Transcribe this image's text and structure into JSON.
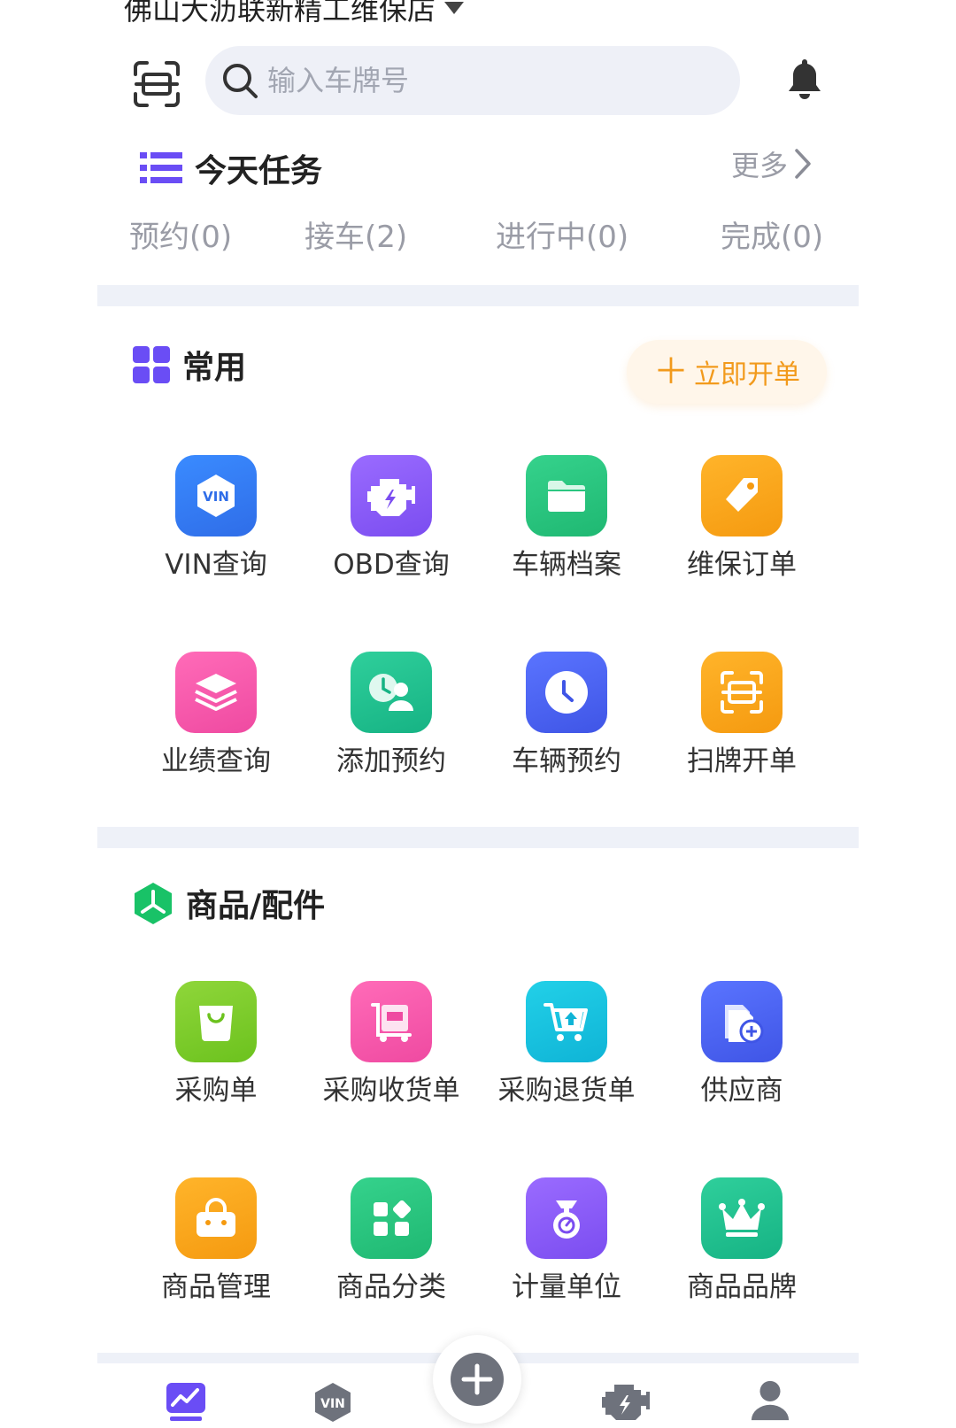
{
  "header": {
    "shop_name": "佛山大沥联新精工维保店",
    "search_placeholder": "输入车牌号"
  },
  "today_tasks": {
    "title": "今天任务",
    "more": "更多",
    "tabs": [
      {
        "label": "预约(0)"
      },
      {
        "label": "接车(2)"
      },
      {
        "label": "进行中(0)"
      },
      {
        "label": "完成(0)"
      }
    ]
  },
  "common": {
    "title": "常用",
    "open_order_label": "立即开单",
    "items": [
      {
        "label": "VIN查询",
        "icon": "vin-icon",
        "color_from": "#3a8bff",
        "color_to": "#2f6de8"
      },
      {
        "label": "OBD查询",
        "icon": "engine-icon",
        "color_from": "#9a6bff",
        "color_to": "#7b4df0"
      },
      {
        "label": "车辆档案",
        "icon": "folder-icon",
        "color_from": "#35d28c",
        "color_to": "#1fb872"
      },
      {
        "label": "维保订单",
        "icon": "tag-icon",
        "color_from": "#ffb42a",
        "color_to": "#f59a10"
      },
      {
        "label": "业绩查询",
        "icon": "layers-icon",
        "color_from": "#ff6bb8",
        "color_to": "#ef4aa1"
      },
      {
        "label": "添加预约",
        "icon": "appointment-user-icon",
        "color_from": "#2fcf9b",
        "color_to": "#16b384"
      },
      {
        "label": "车辆预约",
        "icon": "clock-icon",
        "color_from": "#5a74ff",
        "color_to": "#3f55e6"
      },
      {
        "label": "扫牌开单",
        "icon": "scan-plate-icon",
        "color_from": "#ffb42a",
        "color_to": "#f59a10"
      }
    ]
  },
  "goods": {
    "title": "商品/配件",
    "items": [
      {
        "label": "采购单",
        "icon": "shopping-bag-icon",
        "color_from": "#8fd63a",
        "color_to": "#6cc21e"
      },
      {
        "label": "采购收货单",
        "icon": "receipt-cart-icon",
        "color_from": "#ff6bb8",
        "color_to": "#ef4aa1"
      },
      {
        "label": "采购退货单",
        "icon": "return-cart-icon",
        "color_from": "#22d0e8",
        "color_to": "#0fb4d6"
      },
      {
        "label": "供应商",
        "icon": "supplier-add-icon",
        "color_from": "#5a74ff",
        "color_to": "#3f55e6"
      },
      {
        "label": "商品管理",
        "icon": "basket-icon",
        "color_from": "#ffb42a",
        "color_to": "#f59a10"
      },
      {
        "label": "商品分类",
        "icon": "category-icon",
        "color_from": "#35d28c",
        "color_to": "#1fb872"
      },
      {
        "label": "计量单位",
        "icon": "scale-icon",
        "color_from": "#9a6bff",
        "color_to": "#7b4df0"
      },
      {
        "label": "商品品牌",
        "icon": "crown-icon",
        "color_from": "#2fcf9b",
        "color_to": "#16b384"
      }
    ]
  },
  "bottom_nav": [
    {
      "icon": "dashboard-chart-icon"
    },
    {
      "icon": "vin-nav-icon"
    },
    {
      "icon": "add-fab-icon"
    },
    {
      "icon": "engine-nav-icon"
    },
    {
      "icon": "profile-icon"
    }
  ],
  "colors": {
    "accent_purple": "#6a4df5",
    "accent_orange": "#f29a1c",
    "goods_green": "#19c267",
    "muted_text": "#9a9ca6"
  }
}
